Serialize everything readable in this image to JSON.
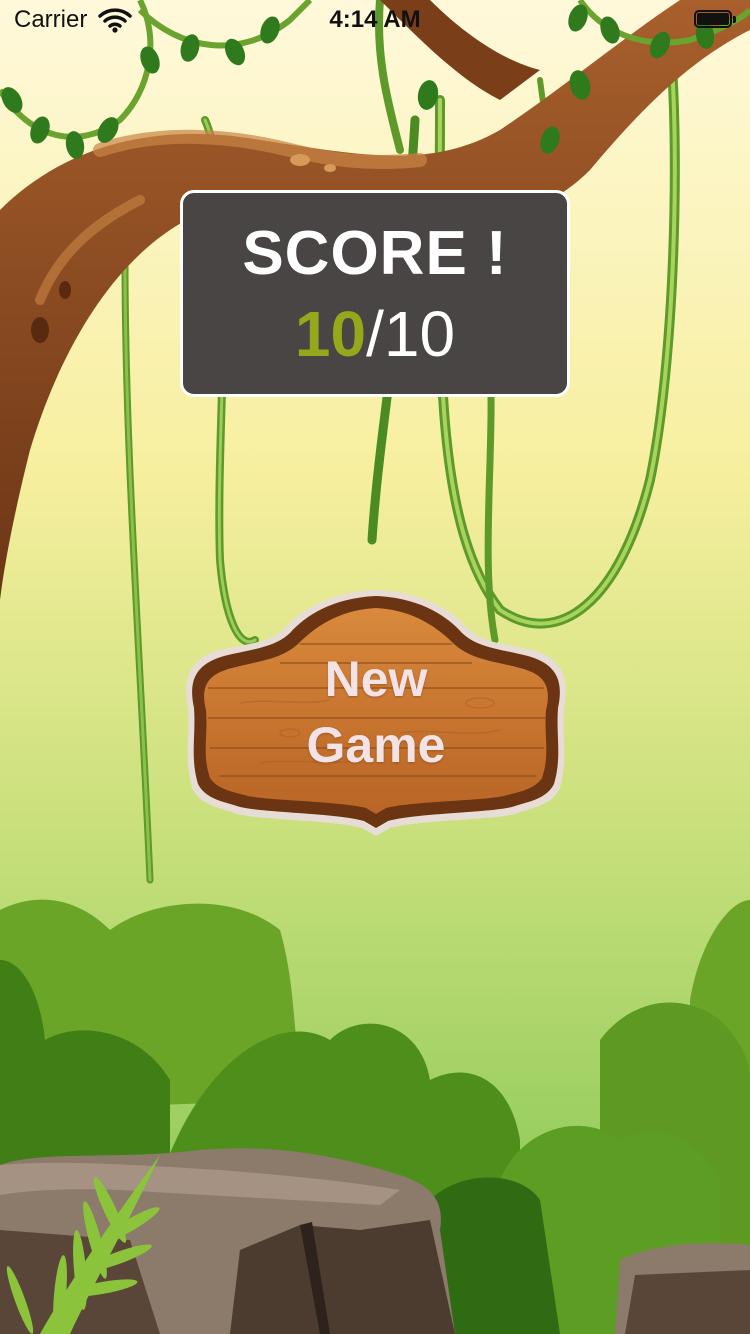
{
  "status_bar": {
    "carrier": "Carrier",
    "time": "4:14 AM",
    "wifi_icon": "wifi-icon",
    "battery_icon": "battery-icon"
  },
  "score_panel": {
    "title": "SCORE !",
    "current": "10",
    "separator": "/",
    "total": "10"
  },
  "new_game_button": {
    "label_line1": "New",
    "label_line2": "Game"
  },
  "colors": {
    "sky_top": "#fff7d6",
    "sky_mid": "#f5ee9e",
    "sky_bottom": "#8ccc55",
    "panel_bg": "#4a4545",
    "score_accent": "#95a81c",
    "wood": "#c9772f",
    "branch": "#8a4a1f"
  }
}
